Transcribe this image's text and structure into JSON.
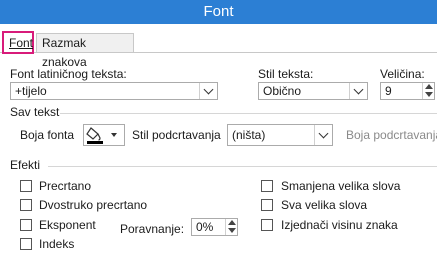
{
  "window": {
    "title": "Font"
  },
  "tabs": [
    {
      "label": "Font"
    },
    {
      "label": "Razmak znakova"
    }
  ],
  "font_latin": {
    "label": "Font latiničnog teksta:",
    "value": "+tijelo"
  },
  "font_style": {
    "label": "Stil teksta:",
    "value": "Obično"
  },
  "size": {
    "label": "Veličina:",
    "value": "9"
  },
  "all_text": {
    "section_label": "Sav tekst",
    "font_color_label": "Boja fonta",
    "underline_style_label": "Stil podcrtavanja",
    "underline_style_value": "(ništa)",
    "underline_color_label": "Boja podcrtavanja"
  },
  "effects": {
    "section_label": "Efekti",
    "left": [
      {
        "label": "Precrtano"
      },
      {
        "label": "Dvostruko precrtano"
      },
      {
        "label": "Eksponent"
      },
      {
        "label": "Indeks"
      }
    ],
    "right": [
      {
        "label": "Smanjena velika slova"
      },
      {
        "label": "Sva velika slova"
      },
      {
        "label": "Izjednači visinu znaka"
      }
    ],
    "offset_label": "Poravnanje:",
    "offset_value": "0%"
  },
  "colors": {
    "title_bar": "#2c7fd4",
    "tab_highlight": "#d81b7a"
  }
}
